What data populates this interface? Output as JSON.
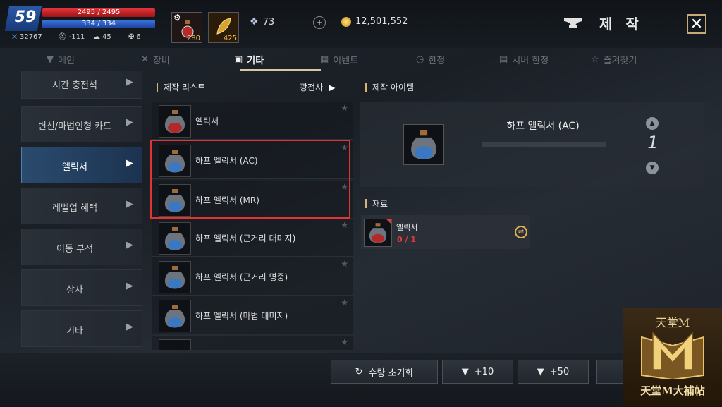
{
  "player": {
    "level": "59",
    "hp": "2495 / 2495",
    "mp": "334 / 334",
    "stats": [
      "32767",
      "-111",
      "45",
      "6"
    ]
  },
  "quick_slots": [
    {
      "icon": "red-potion-icon",
      "count": "280"
    },
    {
      "icon": "golden-leaf-icon",
      "count": "425"
    }
  ],
  "currency": {
    "diamonds": "73",
    "gold": "12,501,552"
  },
  "header": {
    "title": "제 작",
    "close": "✕"
  },
  "tabs": [
    {
      "label": "메인",
      "icon": "anvil-icon",
      "active": false
    },
    {
      "label": "장비",
      "icon": "swords-icon",
      "active": false
    },
    {
      "label": "기타",
      "icon": "box-icon",
      "active": true
    },
    {
      "label": "이벤트",
      "icon": "gift-icon",
      "active": false
    },
    {
      "label": "한정",
      "icon": "timer-icon",
      "active": false
    },
    {
      "label": "서버 한정",
      "icon": "server-icon",
      "active": false
    },
    {
      "label": "즐겨찾기",
      "icon": "star-icon",
      "active": false
    }
  ],
  "categories": [
    {
      "label": "시간 충전석"
    },
    {
      "label": "변신/마법인형 카드"
    },
    {
      "label": "엘릭서",
      "active": true
    },
    {
      "label": "레벨업 혜택"
    },
    {
      "label": "이동 부적"
    },
    {
      "label": "상자"
    },
    {
      "label": "기타"
    }
  ],
  "list": {
    "header": "제작 리스트",
    "filter": "광전사",
    "items": [
      {
        "name": "엘릭서"
      },
      {
        "name": "하프 엘릭서 (AC)"
      },
      {
        "name": "하프 엘릭서 (MR)"
      },
      {
        "name": "하프 엘릭서 (근거리 대미지)"
      },
      {
        "name": "하프 엘릭서 (근거리 명중)"
      },
      {
        "name": "하프 엘릭서 (마법 대미지)"
      },
      {
        "name": ""
      }
    ]
  },
  "craft_item": {
    "header": "제작 아이템",
    "name": "하프 엘릭서 (AC)",
    "quantity": "1"
  },
  "materials": {
    "header": "재료",
    "items": [
      {
        "name": "엘릭서",
        "count": "0 / 1"
      }
    ]
  },
  "bottom_buttons": {
    "reset": "수량 초기화",
    "plus10": "+10",
    "plus50": "+50"
  },
  "watermark": {
    "top": "天堂M",
    "bottom": "天堂M大補帖"
  }
}
